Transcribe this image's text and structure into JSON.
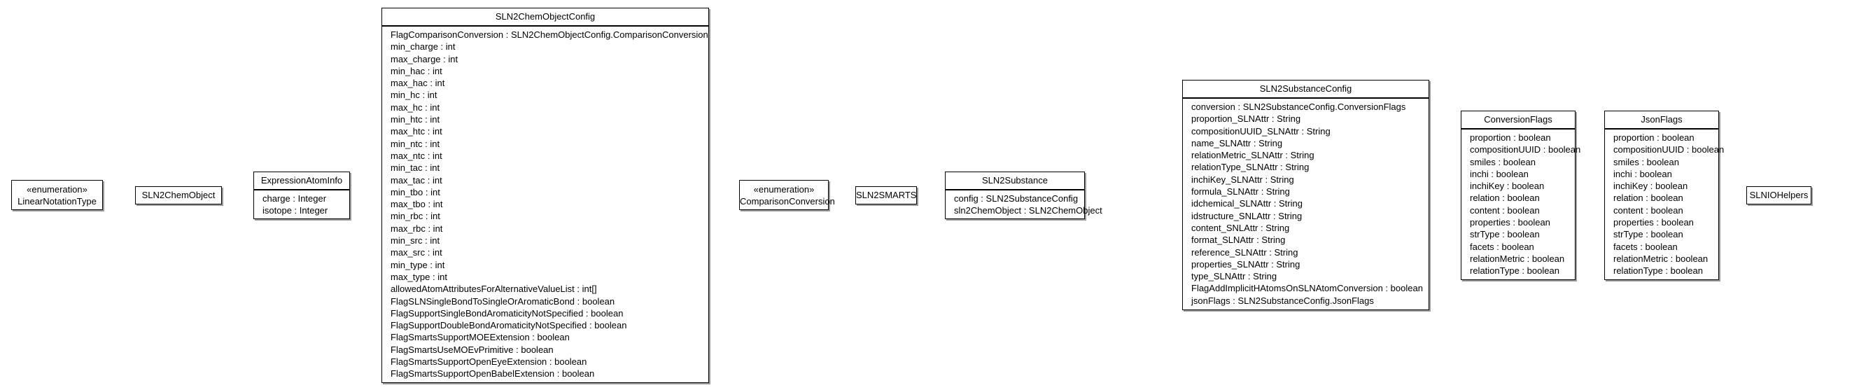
{
  "classes": {
    "linearNotationType": {
      "stereotype": "«enumeration»",
      "name": "LinearNotationType"
    },
    "sln2ChemObject": {
      "name": "SLN2ChemObject"
    },
    "expressionAtomInfo": {
      "name": "ExpressionAtomInfo",
      "attributes": [
        "charge : Integer",
        "isotope : Integer"
      ]
    },
    "sln2ChemObjectConfig": {
      "name": "SLN2ChemObjectConfig",
      "attributes": [
        "FlagComparisonConversion : SLN2ChemObjectConfig.ComparisonConversion",
        "min_charge : int",
        "max_charge : int",
        "min_hac : int",
        "max_hac : int",
        "min_hc : int",
        "max_hc : int",
        "min_htc : int",
        "max_htc : int",
        "min_ntc : int",
        "max_ntc : int",
        "min_tac : int",
        "max_tac : int",
        "min_tbo : int",
        "max_tbo : int",
        "min_rbc : int",
        "max_rbc : int",
        "min_src : int",
        "max_src : int",
        "min_type : int",
        "max_type : int",
        "allowedAtomAttributesForAlternativeValueList : int[]",
        "FlagSLNSingleBondToSingleOrAromaticBond : boolean",
        "FlagSupportSingleBondAromaticityNotSpecified : boolean",
        "FlagSupportDoubleBondAromaticityNotSpecified : boolean",
        "FlagSmartsSupportMOEExtension : boolean",
        "FlagSmartsUseMOEvPrimitive : boolean",
        "FlagSmartsSupportOpenEyeExtension : boolean",
        "FlagSmartsSupportOpenBabelExtension : boolean"
      ]
    },
    "comparisonConversion": {
      "stereotype": "«enumeration»",
      "name": "ComparisonConversion"
    },
    "sln2Smarts": {
      "name": "SLN2SMARTS"
    },
    "sln2Substance": {
      "name": "SLN2Substance",
      "attributes": [
        "config : SLN2SubstanceConfig",
        "sln2ChemObject : SLN2ChemObject"
      ]
    },
    "sln2SubstanceConfig": {
      "name": "SLN2SubstanceConfig",
      "attributes": [
        "conversion : SLN2SubstanceConfig.ConversionFlags",
        "proportion_SLNAttr : String",
        "compositionUUID_SLNAttr : String",
        "name_SLNAttr : String",
        "relationMetric_SLNAttr : String",
        "relationType_SLNAttr : String",
        "inchiKey_SLNAttr : String",
        "formula_SLNAttr : String",
        "idchemical_SLNAttr : String",
        "idstructure_SNLAttr : String",
        "content_SNLAttr : String",
        "format_SLNAttr : String",
        "reference_SLNAttr : String",
        "properties_SLNAttr : String",
        "type_SLNAttr : String",
        "FlagAddImplicitHAtomsOnSLNAtomConversion : boolean",
        "jsonFlags : SLN2SubstanceConfig.JsonFlags"
      ]
    },
    "conversionFlags": {
      "name": "ConversionFlags",
      "attributes": [
        "proportion : boolean",
        "compositionUUID : boolean",
        "smiles : boolean",
        "inchi : boolean",
        "inchiKey : boolean",
        "relation : boolean",
        "content : boolean",
        "properties : boolean",
        "strType : boolean",
        "facets : boolean",
        "relationMetric : boolean",
        "relationType : boolean"
      ]
    },
    "jsonFlags": {
      "name": "JsonFlags",
      "attributes": [
        "proportion : boolean",
        "compositionUUID : boolean",
        "smiles : boolean",
        "inchi : boolean",
        "inchiKey : boolean",
        "relation : boolean",
        "content : boolean",
        "properties : boolean",
        "strType : boolean",
        "facets : boolean",
        "relationMetric : boolean",
        "relationType : boolean"
      ]
    },
    "slnIOHelpers": {
      "name": "SLNIOHelpers"
    }
  }
}
